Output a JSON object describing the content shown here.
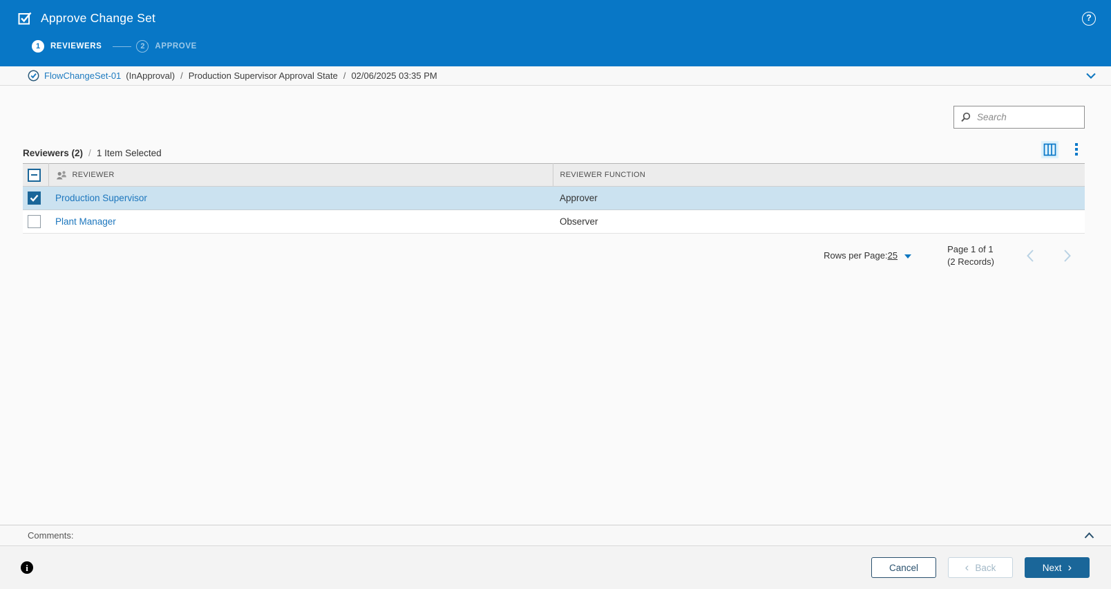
{
  "colors": {
    "header_blue": "#0877c6",
    "link_blue": "#1c76bd",
    "selected_row": "#cbe2f0",
    "checkbox_blue": "#1a6699",
    "primary_button": "#1a6699",
    "dark_navy": "#29506d",
    "disabled_chevron": "#b9d2e4",
    "table_header_bg": "#ececec"
  },
  "header": {
    "title": "Approve Change Set",
    "help_glyph": "?",
    "steps": [
      {
        "num": "1",
        "label": "REVIEWERS"
      },
      {
        "num": "2",
        "label": "APPROVE"
      }
    ]
  },
  "breadcrumb": {
    "object_name": "FlowChangeSet-01",
    "status": "(InApproval)",
    "separator": "/",
    "state": "Production Supervisor Approval State",
    "timestamp": "02/06/2025 03:35 PM"
  },
  "search": {
    "placeholder": "Search"
  },
  "table": {
    "title": "Reviewers (2)",
    "separator": "/",
    "selection_status": "1 Item Selected",
    "columns": {
      "reviewer": "REVIEWER",
      "reviewer_function": "REVIEWER FUNCTION"
    },
    "rows": [
      {
        "reviewer": "Production Supervisor",
        "reviewer_function": "Approver"
      },
      {
        "reviewer": "Plant Manager",
        "reviewer_function": "Observer"
      }
    ]
  },
  "pagination": {
    "rows_per_page_label": "Rows per Page:",
    "rows_per_page_value": "25",
    "page_info": "Page 1 of 1",
    "records_info": "(2 Records)"
  },
  "comments": {
    "label": "Comments:"
  },
  "footer": {
    "info_glyph": "i",
    "cancel": "Cancel",
    "back": "Back",
    "next": "Next",
    "back_chevron": "‹",
    "next_chevron": "›"
  }
}
